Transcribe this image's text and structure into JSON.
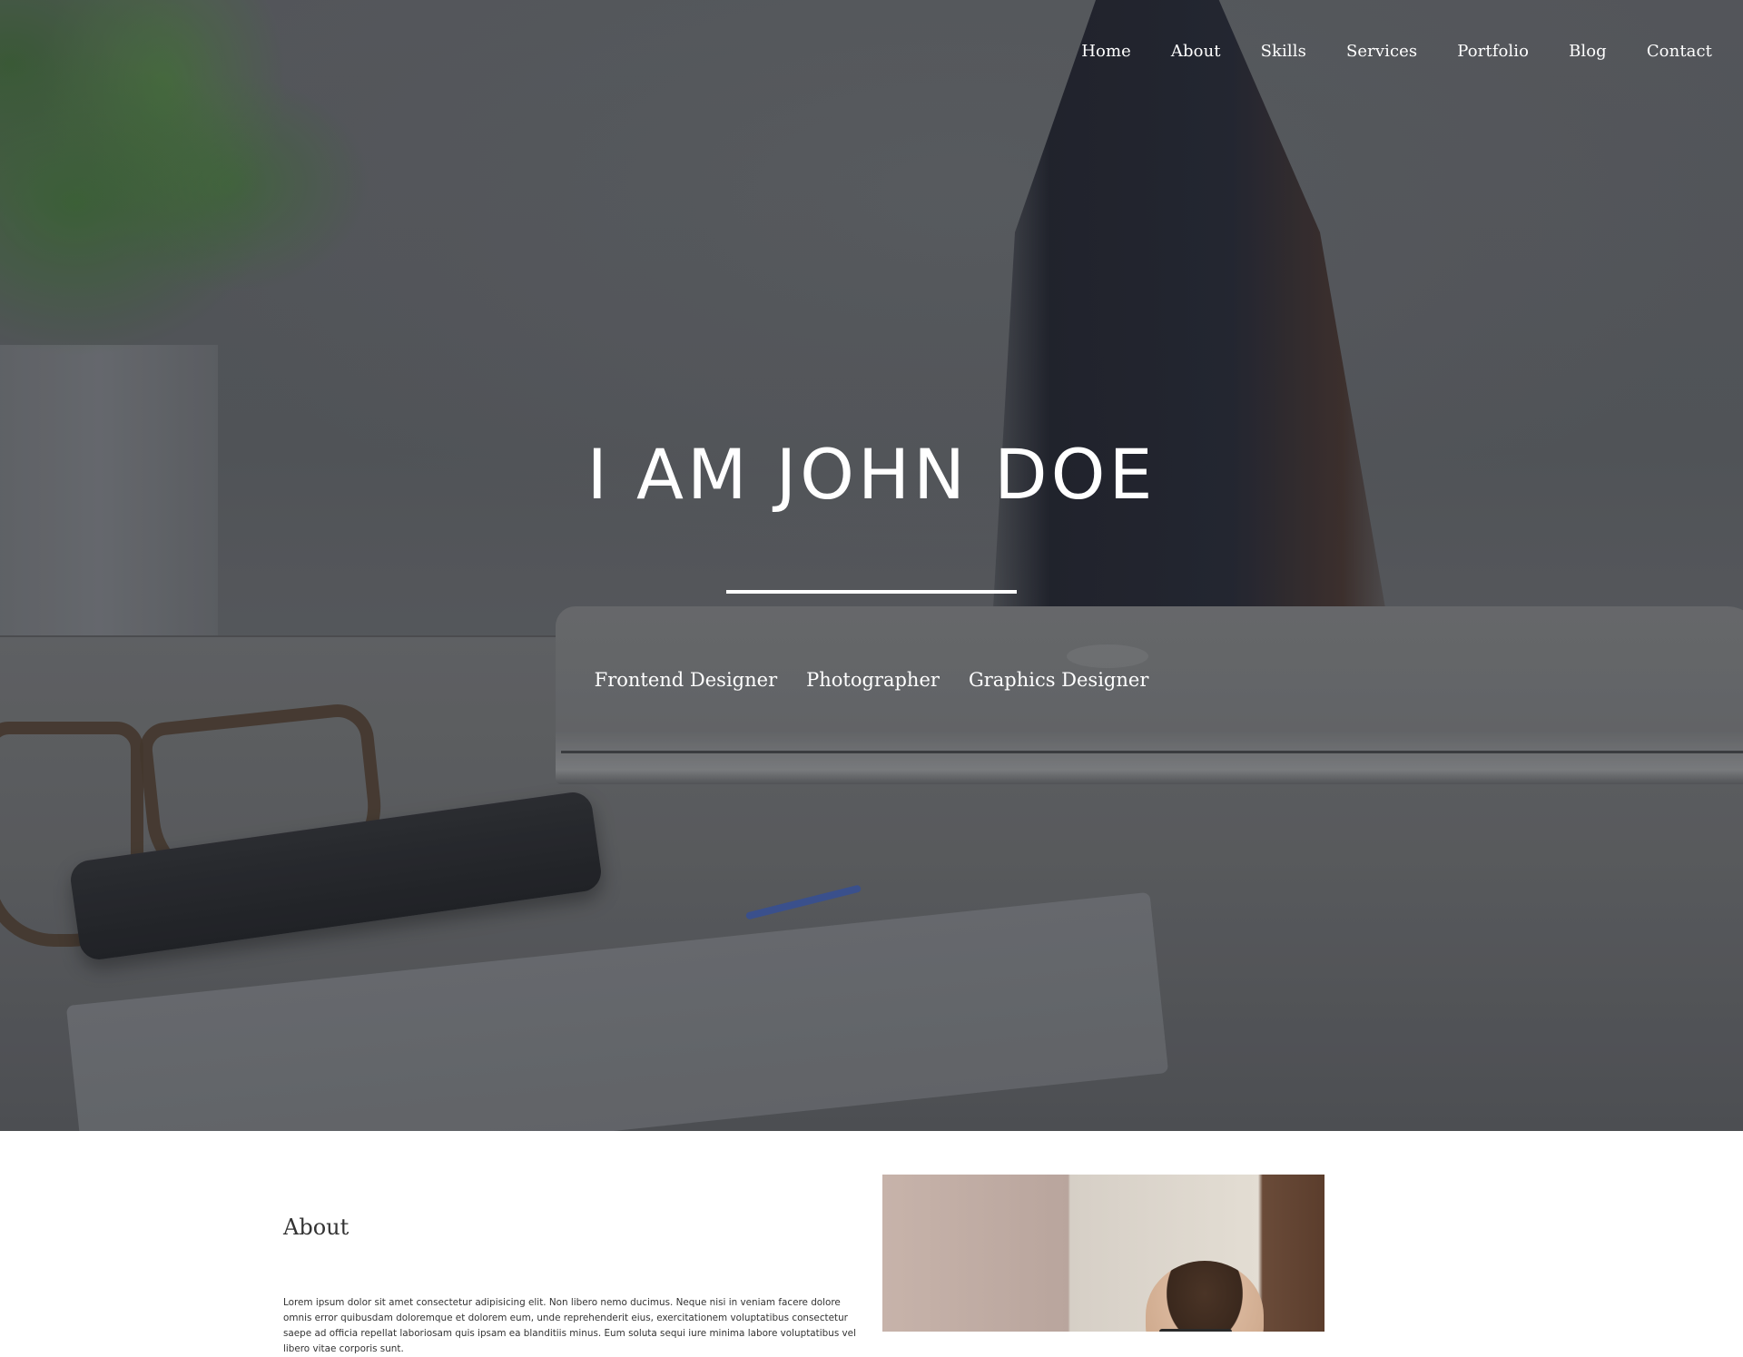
{
  "nav": {
    "items": [
      {
        "label": "Home"
      },
      {
        "label": "About"
      },
      {
        "label": "Skills"
      },
      {
        "label": "Services"
      },
      {
        "label": "Portfolio"
      },
      {
        "label": "Blog"
      },
      {
        "label": "Contact"
      }
    ]
  },
  "hero": {
    "title": "I AM JOHN DOE",
    "roles": [
      "Frontend Designer",
      "Photographer",
      "Graphics Designer"
    ]
  },
  "about": {
    "heading": "About",
    "text": "Lorem ipsum dolor sit amet consectetur adipisicing elit. Non libero nemo ducimus. Neque nisi in veniam facere dolore omnis error quibusdam doloremque et dolorem eum, unde reprehenderit eius, exercitationem voluptatibus consectetur saepe ad officia repellat laboriosam quis ipsam ea blanditiis minus. Eum soluta sequi iure minima labore voluptatibus vel libero vitae corporis sunt."
  },
  "colors": {
    "hero_overlay": "#5d5f63",
    "text_light": "#ffffff",
    "text_dark": "#333333"
  }
}
